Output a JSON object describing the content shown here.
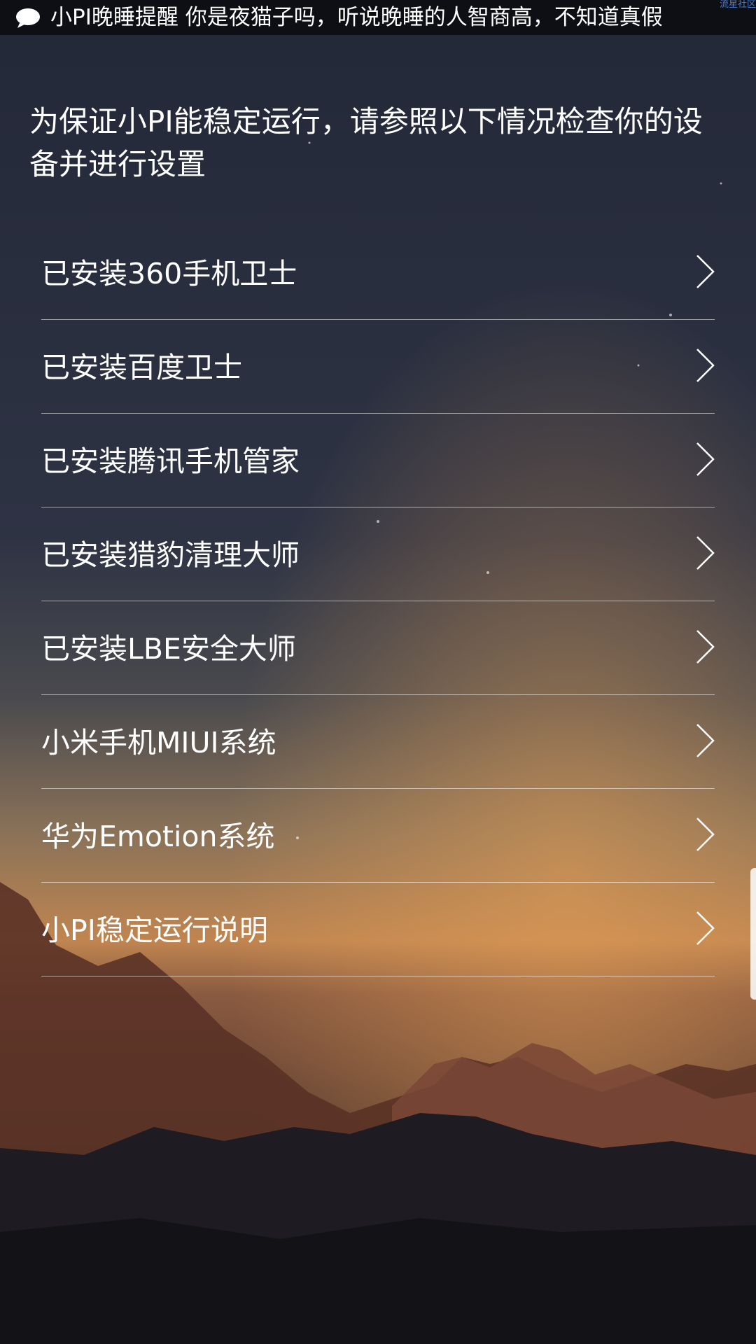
{
  "status_bar": {
    "icon": "chat-bubble-icon",
    "notification": "小PI晚睡提醒 你是夜猫子吗，听说晚睡的人智商高，不知道真假",
    "watermark": "流星社区"
  },
  "intro_text": "为保证小PI能稳定运行，请参照以下情况检查你的设备并进行设置",
  "menu": {
    "items": [
      {
        "label": "已安装360手机卫士"
      },
      {
        "label": "已安装百度卫士"
      },
      {
        "label": "已安装腾讯手机管家"
      },
      {
        "label": "已安装猎豹清理大师"
      },
      {
        "label": "已安装LBE安全大师"
      },
      {
        "label": "小米手机MIUI系统"
      },
      {
        "label": "华为Emotion系统"
      },
      {
        "label": "小PI稳定运行说明"
      }
    ],
    "chevron_icon": "chevron-right-icon"
  },
  "colors": {
    "sky_top": "#252a38",
    "sky_horizon": "#c58a52",
    "mountain_dark": "#16161c",
    "divider": "#b0b0b0"
  }
}
